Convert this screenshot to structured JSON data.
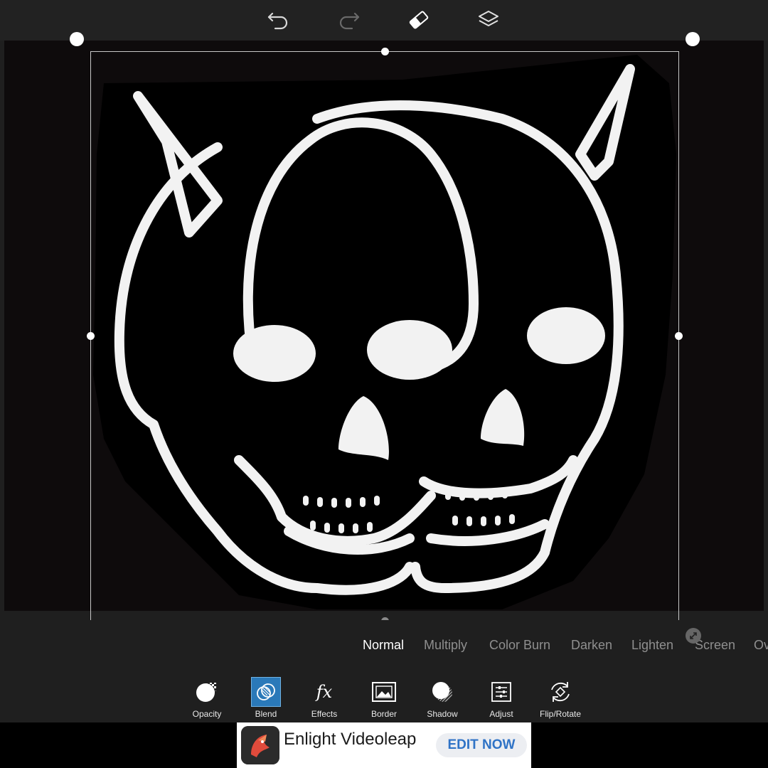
{
  "topbar": {
    "icons": [
      "undo-icon",
      "redo-icon",
      "eraser-icon",
      "layers-icon"
    ]
  },
  "blend": {
    "modes": [
      "Normal",
      "Multiply",
      "Color Burn",
      "Darken",
      "Lighten",
      "Screen",
      "Ov"
    ],
    "selected": "Normal"
  },
  "tools": [
    {
      "label": "Opacity",
      "icon": "opacity-icon"
    },
    {
      "label": "Blend",
      "icon": "blend-icon"
    },
    {
      "label": "Effects",
      "icon": "fx-icon"
    },
    {
      "label": "Border",
      "icon": "border-icon"
    },
    {
      "label": "Shadow",
      "icon": "shadow-icon"
    },
    {
      "label": "Adjust",
      "icon": "adjust-icon"
    },
    {
      "label": "Flip/Rotate",
      "icon": "flip-rotate-icon"
    }
  ],
  "selected_tool": "Blend",
  "ad": {
    "title": "Enlight Videoleap",
    "cta": "EDIT NOW",
    "cta_color": "#2f73c6"
  },
  "colors": {
    "accent": "#2a79b9",
    "background": "#1f1f1f",
    "canvas": "#0e0b0c"
  }
}
